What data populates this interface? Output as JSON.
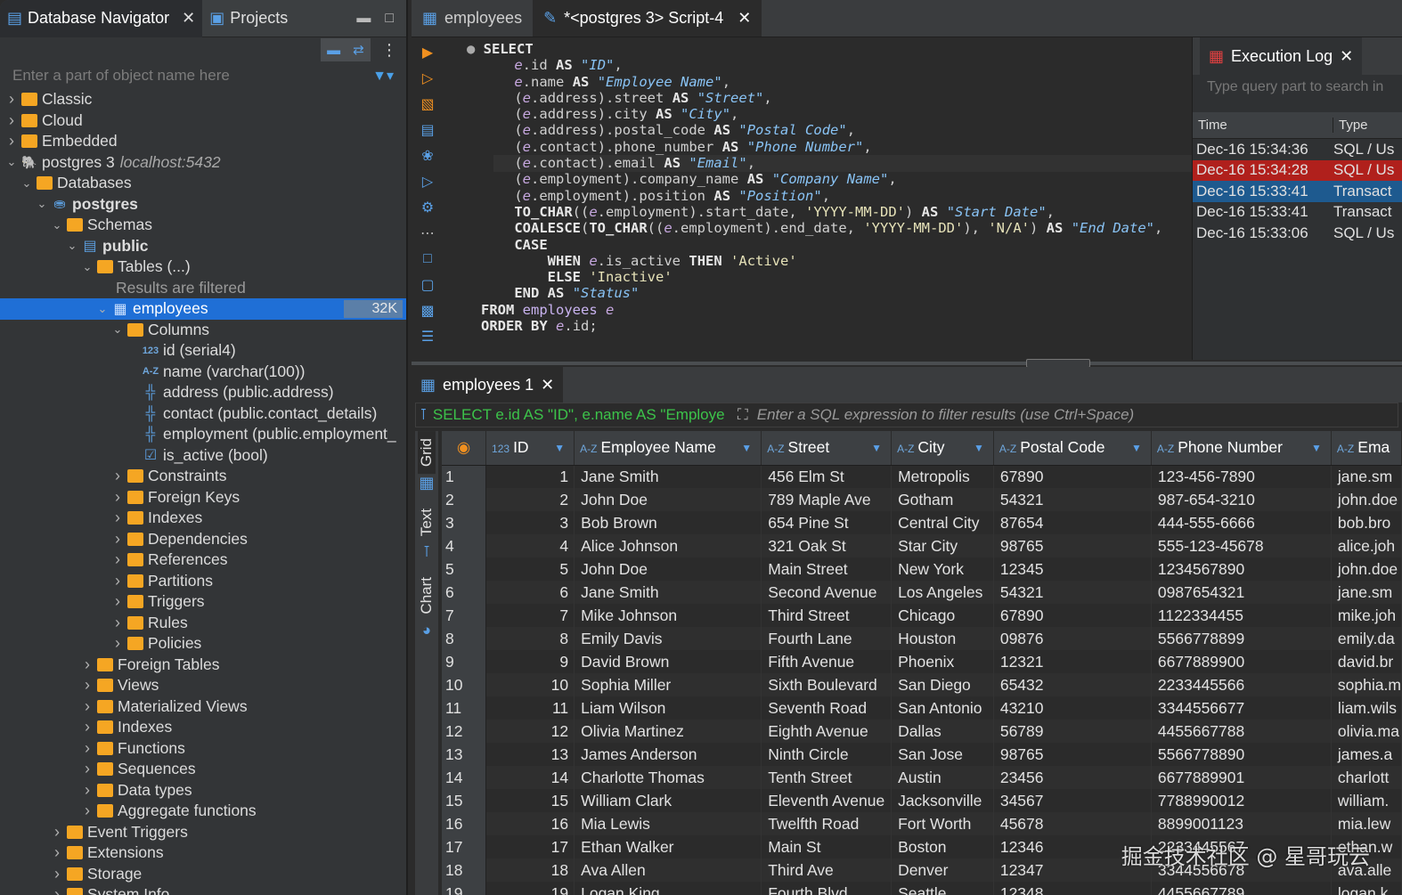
{
  "left_panel": {
    "tabs": [
      {
        "label": "Database Navigator",
        "active": true
      },
      {
        "label": "Projects",
        "active": false
      }
    ],
    "search_placeholder": "Enter a part of object name here",
    "tree": [
      {
        "label": "Classic",
        "level": 0,
        "icon": "folder-db-icon",
        "expanded": false
      },
      {
        "label": "Cloud",
        "level": 0,
        "icon": "folder-db-icon",
        "expanded": false
      },
      {
        "label": "Embedded",
        "level": 0,
        "icon": "folder-db-icon",
        "expanded": false
      },
      {
        "label": "postgres 3",
        "suffix": "localhost:5432",
        "level": 0,
        "icon": "postgres-icon",
        "expanded": true
      },
      {
        "label": "Databases",
        "level": 1,
        "icon": "folder-db-icon",
        "expanded": true
      },
      {
        "label": "postgres",
        "level": 2,
        "icon": "database-icon",
        "expanded": true,
        "bold": true
      },
      {
        "label": "Schemas",
        "level": 3,
        "icon": "folder-schema-icon",
        "expanded": true
      },
      {
        "label": "public",
        "level": 4,
        "icon": "schema-icon",
        "expanded": true,
        "bold": true
      },
      {
        "label": "Tables (...)",
        "level": 5,
        "icon": "folder-table-icon",
        "expanded": true
      },
      {
        "label": "Results are filtered",
        "level": 6,
        "icon": "",
        "muted": true
      },
      {
        "label": "employees",
        "level": 6,
        "icon": "table-icon",
        "expanded": true,
        "selected": true,
        "badge": "32K"
      },
      {
        "label": "Columns",
        "level": 7,
        "icon": "folder-columns-icon",
        "expanded": true
      },
      {
        "label": "id (serial4)",
        "level": 8,
        "icon": "numeric-column-icon",
        "icon_text": "123"
      },
      {
        "label": "name (varchar(100))",
        "level": 8,
        "icon": "text-column-icon",
        "icon_text": "A-Z"
      },
      {
        "label": "address (public.address)",
        "level": 8,
        "icon": "composite-column-icon"
      },
      {
        "label": "contact (public.contact_details)",
        "level": 8,
        "icon": "composite-column-icon"
      },
      {
        "label": "employment (public.employment_",
        "level": 8,
        "icon": "composite-column-icon"
      },
      {
        "label": "is_active (bool)",
        "level": 8,
        "icon": "boolean-column-icon"
      },
      {
        "label": "Constraints",
        "level": 7,
        "icon": "folder-icon",
        "expanded": false
      },
      {
        "label": "Foreign Keys",
        "level": 7,
        "icon": "folder-icon",
        "expanded": false
      },
      {
        "label": "Indexes",
        "level": 7,
        "icon": "folder-icon",
        "expanded": false
      },
      {
        "label": "Dependencies",
        "level": 7,
        "icon": "folder-icon",
        "expanded": false
      },
      {
        "label": "References",
        "level": 7,
        "icon": "folder-icon",
        "expanded": false
      },
      {
        "label": "Partitions",
        "level": 7,
        "icon": "folder-icon",
        "expanded": false
      },
      {
        "label": "Triggers",
        "level": 7,
        "icon": "folder-icon",
        "expanded": false
      },
      {
        "label": "Rules",
        "level": 7,
        "icon": "folder-icon",
        "expanded": false
      },
      {
        "label": "Policies",
        "level": 7,
        "icon": "folder-icon",
        "expanded": false
      },
      {
        "label": "Foreign Tables",
        "level": 5,
        "icon": "folder-icon",
        "expanded": false
      },
      {
        "label": "Views",
        "level": 5,
        "icon": "folder-view-icon",
        "expanded": false
      },
      {
        "label": "Materialized Views",
        "level": 5,
        "icon": "folder-view-icon",
        "expanded": false
      },
      {
        "label": "Indexes",
        "level": 5,
        "icon": "folder-icon",
        "expanded": false
      },
      {
        "label": "Functions",
        "level": 5,
        "icon": "folder-icon",
        "expanded": false
      },
      {
        "label": "Sequences",
        "level": 5,
        "icon": "folder-icon",
        "expanded": false
      },
      {
        "label": "Data types",
        "level": 5,
        "icon": "folder-icon",
        "expanded": false
      },
      {
        "label": "Aggregate functions",
        "level": 5,
        "icon": "folder-icon",
        "expanded": false
      },
      {
        "label": "Event Triggers",
        "level": 3,
        "icon": "folder-icon",
        "expanded": false
      },
      {
        "label": "Extensions",
        "level": 3,
        "icon": "folder-icon",
        "expanded": false
      },
      {
        "label": "Storage",
        "level": 3,
        "icon": "folder-icon",
        "expanded": false
      },
      {
        "label": "System Info",
        "level": 3,
        "icon": "folder-icon",
        "expanded": false
      }
    ]
  },
  "editor": {
    "tabs": [
      {
        "label": "employees",
        "active": false,
        "closable": false
      },
      {
        "label": "*<postgres 3> Script-4",
        "active": true,
        "closable": true
      }
    ],
    "sql_lines": [
      "SELECT",
      "    e.id AS \"ID\",",
      "    e.name AS \"Employee Name\",",
      "    (e.address).street AS \"Street\",",
      "    (e.address).city AS \"City\",",
      "    (e.address).postal_code AS \"Postal Code\",",
      "    (e.contact).phone_number AS \"Phone Number\",",
      "    (e.contact).email AS \"Email\",",
      "    (e.employment).company_name AS \"Company Name\",",
      "    (e.employment).position AS \"Position\",",
      "    TO_CHAR((e.employment).start_date, 'YYYY-MM-DD') AS \"Start Date\",",
      "    COALESCE(TO_CHAR((e.employment).end_date, 'YYYY-MM-DD'), 'N/A') AS \"End Date\",",
      "    CASE",
      "        WHEN e.is_active THEN 'Active'",
      "        ELSE 'Inactive'",
      "    END AS \"Status\"",
      "FROM employees e",
      "ORDER BY e.id;"
    ]
  },
  "execution_log": {
    "title": "Execution Log",
    "search_placeholder": "Type query part to search in",
    "columns": [
      "Time",
      "Type"
    ],
    "rows": [
      {
        "time": "Dec-16 15:34:36",
        "type": "SQL / Us",
        "state": "normal"
      },
      {
        "time": "Dec-16 15:34:28",
        "type": "SQL / Us",
        "state": "error"
      },
      {
        "time": "Dec-16 15:33:41",
        "type": "Transact",
        "state": "highlight"
      },
      {
        "time": "Dec-16 15:33:41",
        "type": "Transact",
        "state": "normal"
      },
      {
        "time": "Dec-16 15:33:06",
        "type": "SQL / Us",
        "state": "normal"
      }
    ]
  },
  "results": {
    "tab_label": "employees 1",
    "filter_query": "SELECT e.id AS \"ID\", e.name AS \"Employe",
    "filter_hint": "Enter a SQL expression to filter results (use Ctrl+Space)",
    "side_tabs": [
      "Grid",
      "Text",
      "Chart"
    ],
    "columns": [
      {
        "label": "ID",
        "type": "123"
      },
      {
        "label": "Employee Name",
        "type": "A-Z"
      },
      {
        "label": "Street",
        "type": "A-Z"
      },
      {
        "label": "City",
        "type": "A-Z"
      },
      {
        "label": "Postal Code",
        "type": "A-Z"
      },
      {
        "label": "Phone Number",
        "type": "A-Z"
      },
      {
        "label": "Ema",
        "type": "A-Z"
      }
    ],
    "rows": [
      [
        "1",
        "1",
        "Jane Smith",
        "456 Elm St",
        "Metropolis",
        "67890",
        "123-456-7890",
        "jane.sm"
      ],
      [
        "2",
        "2",
        "John Doe",
        "789 Maple Ave",
        "Gotham",
        "54321",
        "987-654-3210",
        "john.doe"
      ],
      [
        "3",
        "3",
        "Bob Brown",
        "654 Pine St",
        "Central City",
        "87654",
        "444-555-6666",
        "bob.bro"
      ],
      [
        "4",
        "4",
        "Alice Johnson",
        "321 Oak St",
        "Star City",
        "98765",
        "555-123-45678",
        "alice.joh"
      ],
      [
        "5",
        "5",
        "John Doe",
        "Main Street",
        "New York",
        "12345",
        "1234567890",
        "john.doe"
      ],
      [
        "6",
        "6",
        "Jane Smith",
        "Second Avenue",
        "Los Angeles",
        "54321",
        "0987654321",
        "jane.sm"
      ],
      [
        "7",
        "7",
        "Mike Johnson",
        "Third Street",
        "Chicago",
        "67890",
        "1122334455",
        "mike.joh"
      ],
      [
        "8",
        "8",
        "Emily Davis",
        "Fourth Lane",
        "Houston",
        "09876",
        "5566778899",
        "emily.da"
      ],
      [
        "9",
        "9",
        "David Brown",
        "Fifth Avenue",
        "Phoenix",
        "12321",
        "6677889900",
        "david.br"
      ],
      [
        "10",
        "10",
        "Sophia Miller",
        "Sixth Boulevard",
        "San Diego",
        "65432",
        "2233445566",
        "sophia.m"
      ],
      [
        "11",
        "11",
        "Liam Wilson",
        "Seventh Road",
        "San Antonio",
        "43210",
        "3344556677",
        "liam.wils"
      ],
      [
        "12",
        "12",
        "Olivia Martinez",
        "Eighth Avenue",
        "Dallas",
        "56789",
        "4455667788",
        "olivia.ma"
      ],
      [
        "13",
        "13",
        "James Anderson",
        "Ninth Circle",
        "San Jose",
        "98765",
        "5566778890",
        "james.a"
      ],
      [
        "14",
        "14",
        "Charlotte Thomas",
        "Tenth Street",
        "Austin",
        "23456",
        "6677889901",
        "charlott"
      ],
      [
        "15",
        "15",
        "William Clark",
        "Eleventh Avenue",
        "Jacksonville",
        "34567",
        "7788990012",
        "william."
      ],
      [
        "16",
        "16",
        "Mia Lewis",
        "Twelfth Road",
        "Fort Worth",
        "45678",
        "8899001123",
        "mia.lew"
      ],
      [
        "17",
        "17",
        "Ethan Walker",
        "Main St",
        "Boston",
        "12346",
        "2233445567",
        "ethan.w"
      ],
      [
        "18",
        "18",
        "Ava Allen",
        "Third Ave",
        "Denver",
        "12347",
        "3344556678",
        "ava.alle"
      ],
      [
        "19",
        "19",
        "Logan King",
        "Fourth Blvd",
        "Seattle",
        "12348",
        "4455667789",
        "logan.k"
      ]
    ]
  },
  "watermark": "掘金技术社区 @ 星哥玩云",
  "colors": {
    "selection": "#1f6fd6",
    "error_row": "#b0201c",
    "highlight_row": "#1e5a8f",
    "folder": "#f5a623",
    "filter_query": "#3cc34a"
  }
}
